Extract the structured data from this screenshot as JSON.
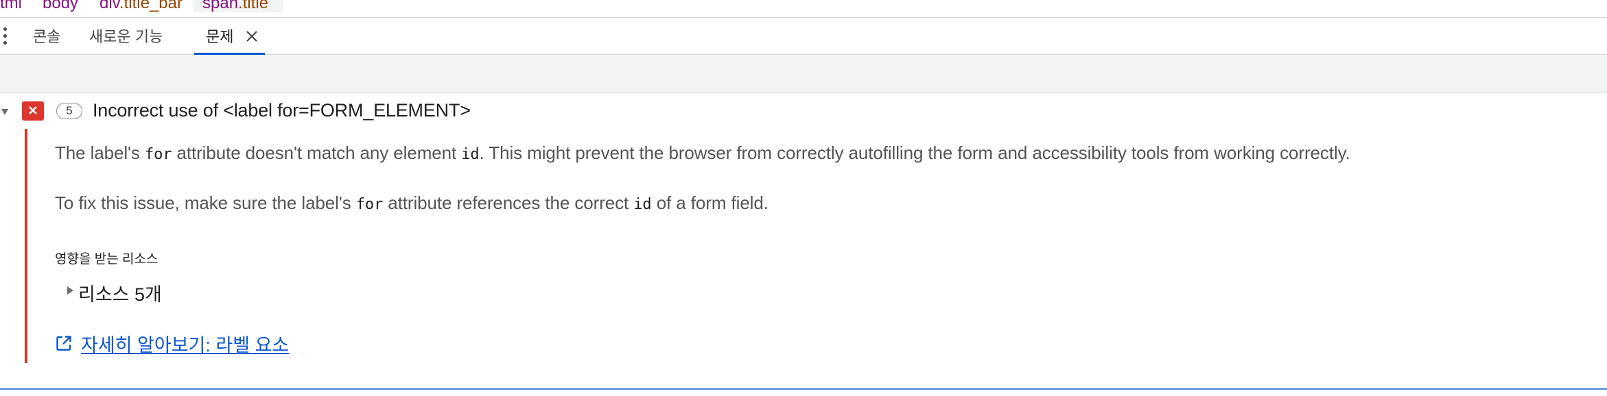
{
  "breadcrumb": {
    "items": [
      {
        "tag": "tml",
        "cls": ""
      },
      {
        "tag": "body",
        "cls": ""
      },
      {
        "tag": "div",
        "cls": ".title_bar"
      },
      {
        "tag": "span",
        "cls": ".title"
      }
    ]
  },
  "tabs": {
    "console": "콘솔",
    "whats_new": "새로운 기능",
    "issues": "문제"
  },
  "issue": {
    "count": "5",
    "title": "Incorrect use of <label for=FORM_ELEMENT>",
    "p1": {
      "a": "The label's ",
      "code1": "for",
      "b": " attribute doesn't match any element ",
      "code2": "id",
      "c": ". This might prevent the browser from correctly autofilling the form and accessibility tools from working correctly."
    },
    "p2": {
      "a": "To fix this issue, make sure the label's ",
      "code1": "for",
      "b": " attribute references the correct ",
      "code2": "id",
      "c": " of a form field."
    },
    "affected_label": "영향을 받는 리소스",
    "resources_toggle": "리소스 5개",
    "learn_more": "자세히 알아보기: 라벨 요소"
  },
  "colors": {
    "accent": "#0b57d0",
    "error": "#dc362e",
    "tag": "#881280",
    "attr_class": "#994500"
  },
  "icons": {
    "menu": "kebab-menu-icon",
    "close": "close-icon",
    "disclosure": "triangle-down-icon",
    "error": "error-badge-icon",
    "expand": "triangle-right-icon",
    "external": "external-link-icon"
  }
}
